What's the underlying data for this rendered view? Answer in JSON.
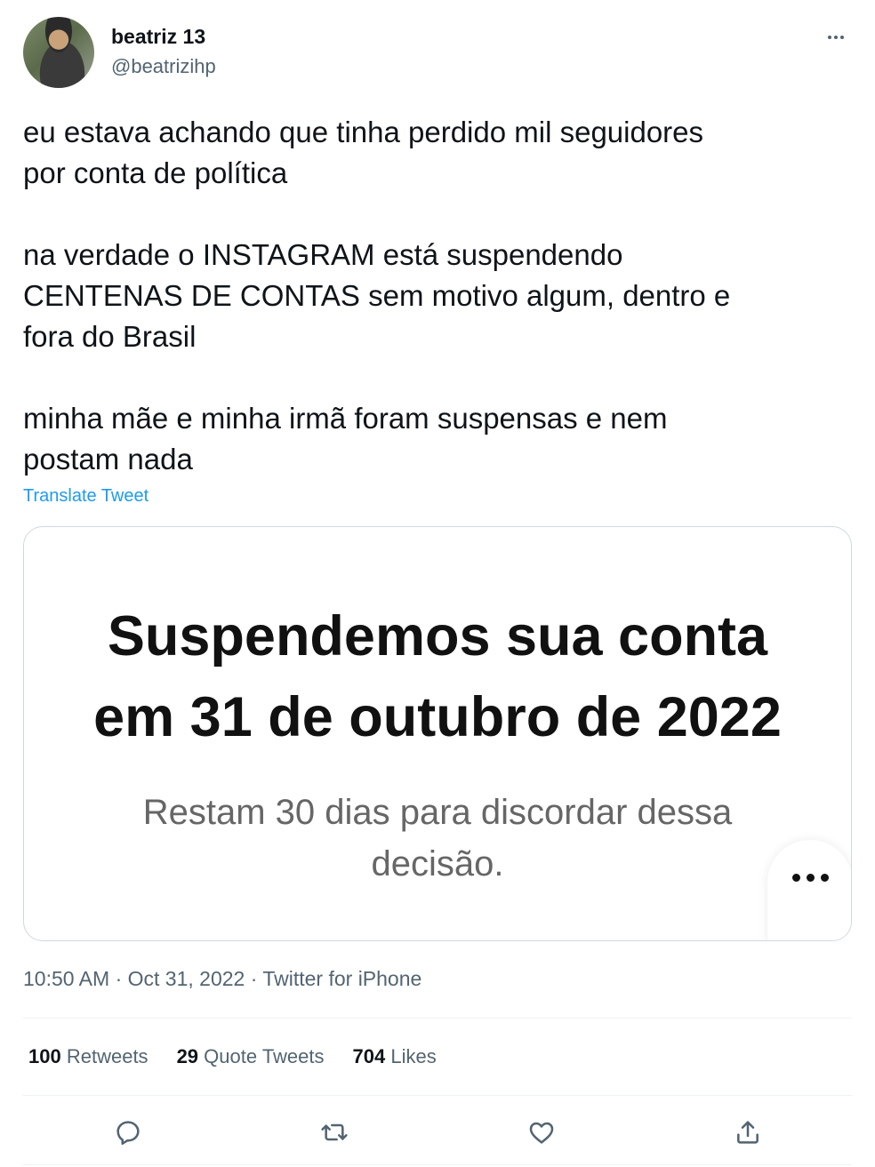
{
  "user": {
    "name": "beatriz 13",
    "handle": "@beatrizihp"
  },
  "tweet": {
    "text": "eu estava achando que tinha perdido mil seguidores\npor conta de política\n\nna verdade o INSTAGRAM está suspendendo\nCENTENAS DE CONTAS sem motivo algum, dentro e\nfora do Brasil\n\nminha mãe e minha irmã foram suspensas e nem\npostam nada",
    "translate_label": "Translate Tweet",
    "timestamp": "10:50 AM · Oct 31, 2022 · Twitter for iPhone"
  },
  "media": {
    "title_line1": "Suspendemos sua conta",
    "title_line2": "em 31 de outubro de 2022",
    "subtitle_line1": "Restam 30 dias para discordar dessa",
    "subtitle_line2": "decisão."
  },
  "stats": {
    "retweets_count": "100",
    "retweets_label": "Retweets",
    "quotes_count": "29",
    "quotes_label": "Quote Tweets",
    "likes_count": "704",
    "likes_label": "Likes"
  },
  "icons": {
    "more": "more-horizontal-icon",
    "reply": "reply-icon",
    "retweet": "retweet-icon",
    "like": "heart-icon",
    "share": "share-icon"
  },
  "colors": {
    "link": "#1d9bf0",
    "secondary_text": "#536471",
    "primary_text": "#0f1419",
    "border": "#cfd9de"
  }
}
